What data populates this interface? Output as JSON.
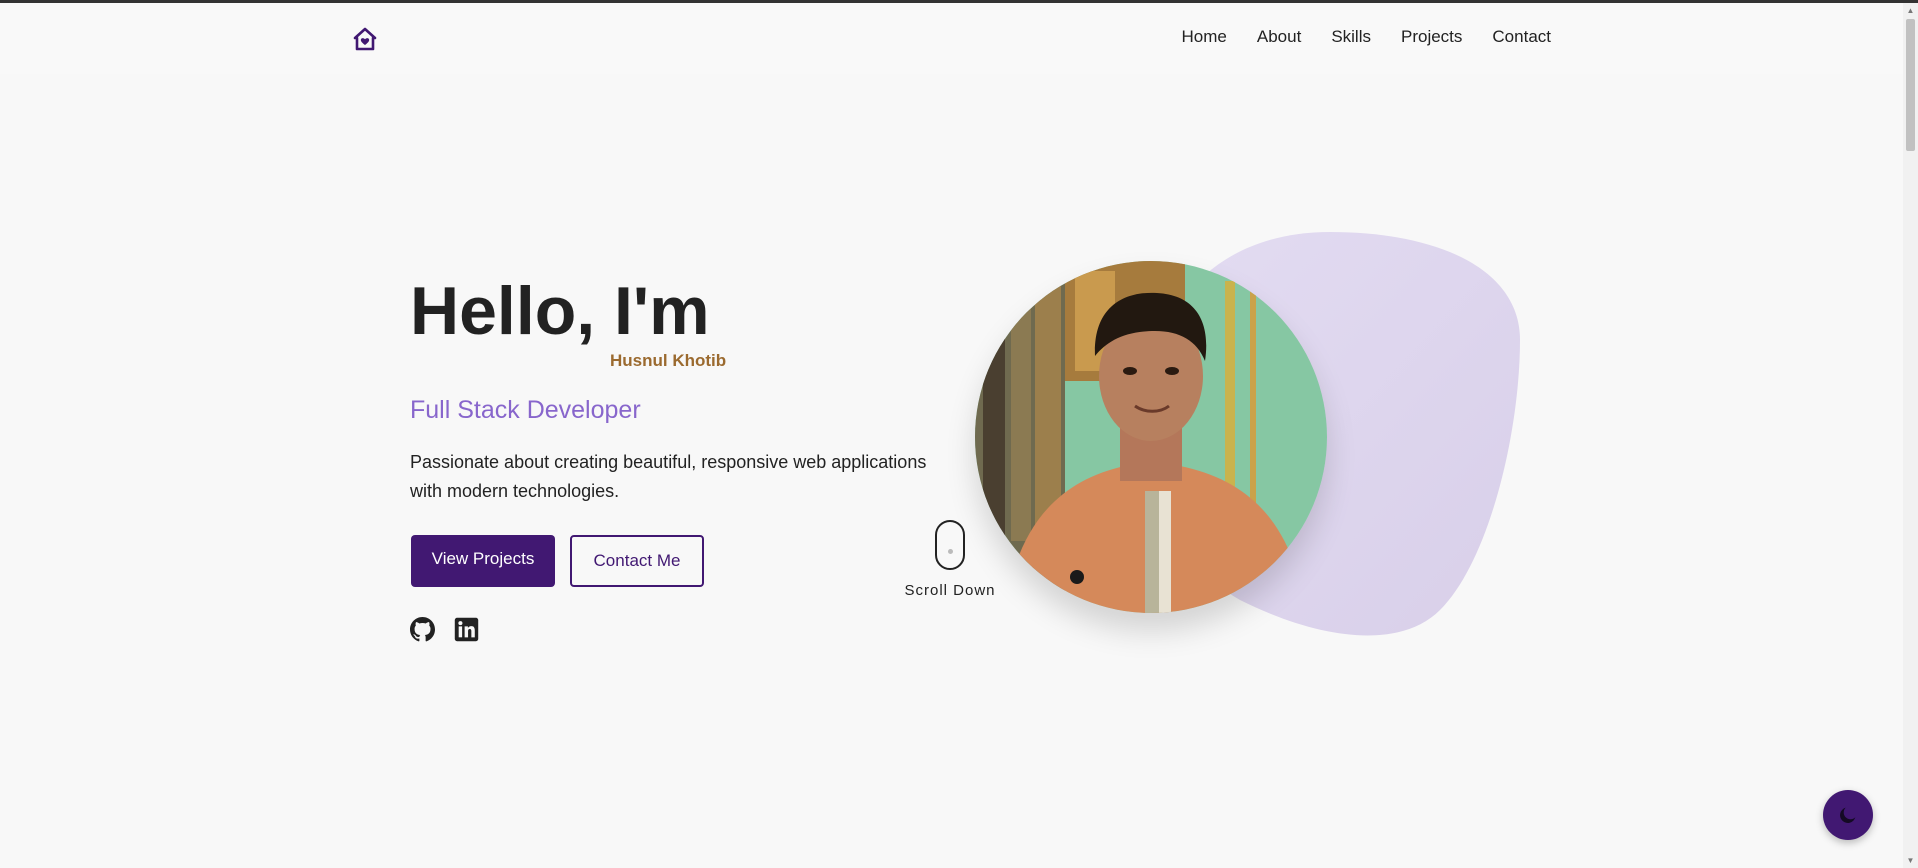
{
  "nav": {
    "logo_icon": "home-heart-icon",
    "links": [
      "Home",
      "About",
      "Skills",
      "Projects",
      "Contact"
    ]
  },
  "hero": {
    "greeting": "Hello, I'm",
    "name": "Husnul Khotib",
    "role": "Full Stack Developer",
    "description": "Passionate about creating beautiful, responsive web applications with modern technologies.",
    "primary_button": "View Projects",
    "secondary_button": "Contact Me",
    "social_icons": [
      "github-icon",
      "linkedin-icon"
    ]
  },
  "scroll": {
    "label": "Scroll Down",
    "icon": "mouse-icon"
  },
  "theme_toggle": {
    "icon": "moon-icon"
  },
  "colors": {
    "accent": "#411872",
    "role_text": "#8866cc",
    "name_text": "#9b6a2f",
    "blob": "#ddd4ee"
  }
}
